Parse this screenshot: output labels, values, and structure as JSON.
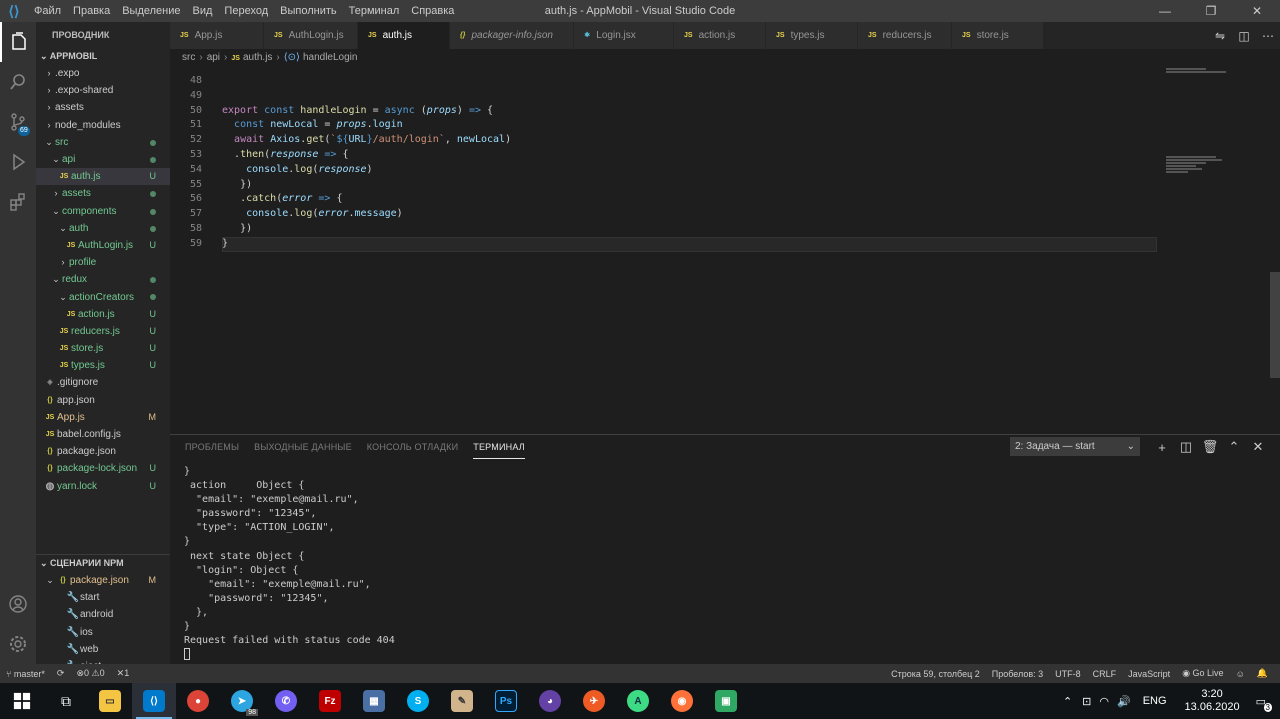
{
  "titlebar": {
    "menu": [
      "Файл",
      "Правка",
      "Выделение",
      "Вид",
      "Переход",
      "Выполнить",
      "Терминал",
      "Справка"
    ],
    "title": "auth.js - AppMobil - Visual Studio Code"
  },
  "sidebar": {
    "header": "ПРОВОДНИК",
    "project": "APPMOBIL",
    "npm_header": "СЦЕНАРИИ NPM",
    "tree": [
      {
        "label": ".expo",
        "type": "folder",
        "status": ""
      },
      {
        "label": ".expo-shared",
        "type": "folder",
        "status": ""
      },
      {
        "label": "assets",
        "type": "folder",
        "status": ""
      },
      {
        "label": "node_modules",
        "type": "folder",
        "status": ""
      },
      {
        "label": "src",
        "type": "folder-open",
        "status": "dot"
      },
      {
        "label": "api",
        "type": "folder-open",
        "status": "dot"
      },
      {
        "label": "auth.js",
        "type": "js",
        "status": "U"
      },
      {
        "label": "assets",
        "type": "folder",
        "status": "dot"
      },
      {
        "label": "components",
        "type": "folder-open",
        "status": "dot"
      },
      {
        "label": "auth",
        "type": "folder-open",
        "status": "dot"
      },
      {
        "label": "AuthLogin.js",
        "type": "js",
        "status": "U"
      },
      {
        "label": "profile",
        "type": "folder",
        "status": ""
      },
      {
        "label": "redux",
        "type": "folder-open",
        "status": "dot"
      },
      {
        "label": "actionCreators",
        "type": "folder-open",
        "status": "dot"
      },
      {
        "label": "action.js",
        "type": "js",
        "status": "U"
      },
      {
        "label": "reducers.js",
        "type": "js",
        "status": "U"
      },
      {
        "label": "store.js",
        "type": "js",
        "status": "U"
      },
      {
        "label": "types.js",
        "type": "js",
        "status": "U"
      },
      {
        "label": ".gitignore",
        "type": "git",
        "status": ""
      },
      {
        "label": "app.json",
        "type": "json",
        "status": ""
      },
      {
        "label": "App.js",
        "type": "js",
        "status": "M"
      },
      {
        "label": "babel.config.js",
        "type": "js",
        "status": ""
      },
      {
        "label": "package.json",
        "type": "json",
        "status": ""
      },
      {
        "label": "package-lock.json",
        "type": "json",
        "status": "U"
      },
      {
        "label": "yarn.lock",
        "type": "yarn",
        "status": "U"
      }
    ],
    "npm": [
      {
        "label": "package.json",
        "status": "M"
      },
      {
        "label": "start"
      },
      {
        "label": "android"
      },
      {
        "label": "ios"
      },
      {
        "label": "web"
      },
      {
        "label": "eject"
      }
    ]
  },
  "tabs": [
    {
      "label": "App.js",
      "icon": "JS"
    },
    {
      "label": "AuthLogin.js",
      "icon": "JS"
    },
    {
      "label": "auth.js",
      "icon": "JS",
      "active": true
    },
    {
      "label": "packager-info.json",
      "icon": "{}"
    },
    {
      "label": "Login.jsx",
      "icon": "⚛"
    },
    {
      "label": "action.js",
      "icon": "JS"
    },
    {
      "label": "types.js",
      "icon": "JS"
    },
    {
      "label": "reducers.js",
      "icon": "JS"
    },
    {
      "label": "store.js",
      "icon": "JS"
    }
  ],
  "breadcrumb": [
    "src",
    "api",
    "auth.js",
    "handleLogin"
  ],
  "editor": {
    "lines": [
      {
        "n": "48",
        "html": ""
      },
      {
        "n": "49",
        "html": ""
      },
      {
        "n": "50",
        "html": "<span class='kw'>export</span> <span class='kb'>const</span> <span class='fn'>handleLogin</span> <span class='op'>=</span> <span class='kb'>async</span> <span class='op'>(</span><span class='pr'>props</span><span class='op'>) </span><span class='kb'>=&gt;</span> <span class='op'>{</span>"
      },
      {
        "n": "51",
        "html": "  <span class='kb'>const</span> <span class='vr'>newLocal</span> <span class='op'>=</span> <span class='pr'>props</span><span class='op'>.</span><span class='vr'>login</span>"
      },
      {
        "n": "52",
        "html": "  <span class='kw'>await</span> <span class='vr'>Axios</span><span class='op'>.</span><span class='fn'>get</span><span class='op'>(</span><span class='st2'>`</span><span class='kb'>${</span><span class='vr'>URL</span><span class='kb'>}</span><span class='st2'>/auth/login`</span><span class='op'>, </span><span class='vr'>newLocal</span><span class='op'>)</span>"
      },
      {
        "n": "53",
        "html": "  <span class='op'>.</span><span class='fn'>then</span><span class='op'>(</span><span class='pr'>response</span> <span class='kb'>=&gt;</span> <span class='op'>{</span>"
      },
      {
        "n": "54",
        "html": "    <span class='vr'>console</span><span class='op'>.</span><span class='fn'>log</span><span class='op'>(</span><span class='pr'>response</span><span class='op'>)</span>"
      },
      {
        "n": "55",
        "html": "   <span class='op'>})</span>"
      },
      {
        "n": "56",
        "html": "   <span class='op'>.</span><span class='fn'>catch</span><span class='op'>(</span><span class='pr'>error</span> <span class='kb'>=&gt;</span> <span class='op'>{</span>"
      },
      {
        "n": "57",
        "html": "    <span class='vr'>console</span><span class='op'>.</span><span class='fn'>log</span><span class='op'>(</span><span class='pr'>error</span><span class='op'>.</span><span class='vr'>message</span><span class='op'>)</span>"
      },
      {
        "n": "58",
        "html": "   <span class='op'>})</span>"
      },
      {
        "n": "59",
        "html": "<span class='op'>}</span>"
      }
    ],
    "current_line": "59"
  },
  "panel": {
    "tabs": [
      "ПРОБЛЕМЫ",
      "ВЫХОДНЫЕ ДАННЫЕ",
      "КОНСОЛЬ ОТЛАДКИ",
      "ТЕРМИНАЛ"
    ],
    "active_tab": "ТЕРМИНАЛ",
    "terminal_select": "2: Задача — start",
    "terminal_lines": [
      "}",
      " action     Object {",
      "  \"email\": \"exemple@mail.ru\",",
      "  \"password\": \"12345\",",
      "  \"type\": \"ACTION_LOGIN\",",
      "}",
      " next state Object {",
      "  \"login\": Object {",
      "    \"email\": \"exemple@mail.ru\",",
      "    \"password\": \"12345\",",
      "  },",
      "}",
      "Request failed with status code 404"
    ]
  },
  "statusbar": {
    "branch": "master*",
    "errors": "0",
    "warnings": "0",
    "processes": "1",
    "position": "Строка 59, столбец 2",
    "spaces": "Пробелов: 3",
    "encoding": "UTF-8",
    "eol": "CRLF",
    "language": "JavaScript",
    "golive": "Go Live"
  },
  "taskbar": {
    "lang": "ENG",
    "time": "3:20",
    "date": "13.06.2020",
    "notifications": "3",
    "telegram_badge": "98",
    "scm_badge": "69"
  }
}
